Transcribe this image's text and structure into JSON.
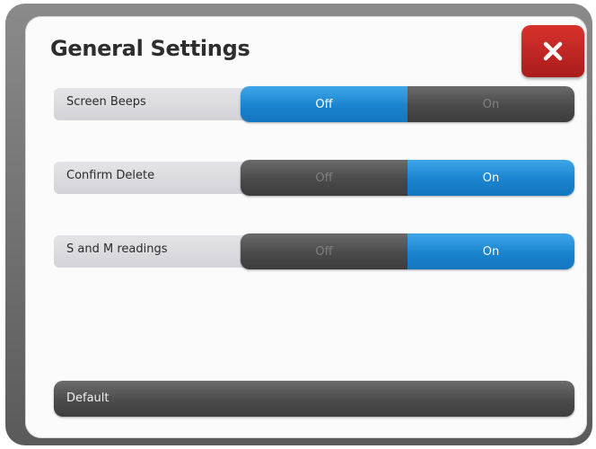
{
  "dialog": {
    "title": "General Settings",
    "close_icon": "close-icon",
    "accent_color": "#1a83cf",
    "close_color": "#c02622"
  },
  "settings": [
    {
      "label": "Screen Beeps",
      "off_label": "Off",
      "on_label": "On",
      "value": "Off"
    },
    {
      "label": "Confirm Delete",
      "off_label": "Off",
      "on_label": "On",
      "value": "On"
    },
    {
      "label": "S and M readings",
      "off_label": "Off",
      "on_label": "On",
      "value": "On"
    }
  ],
  "footer": {
    "default_label": "Default"
  }
}
